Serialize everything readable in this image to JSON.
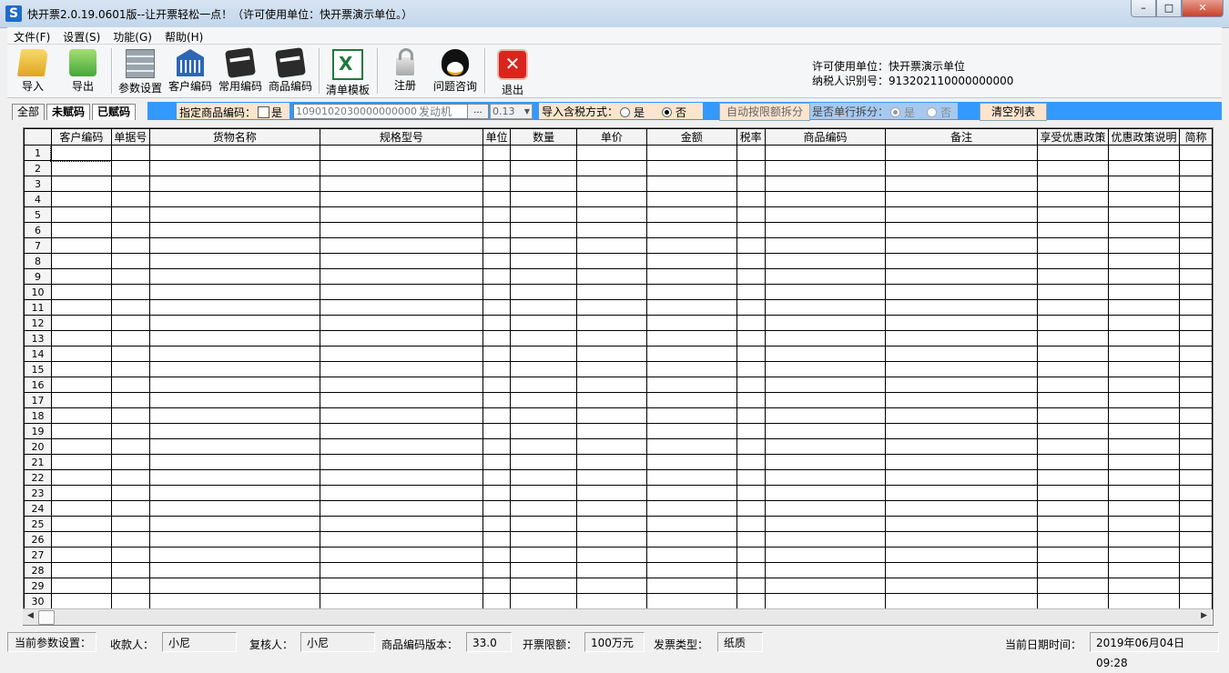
{
  "window": {
    "title": "快开票2.0.19.0601版--让开票轻松一点！（许可使用单位：快开票演示单位。）",
    "app_icon": "S",
    "minimize": "–",
    "maximize": "□",
    "close": "✕"
  },
  "menu": [
    {
      "label": "文件(F)"
    },
    {
      "label": "设置(S)"
    },
    {
      "label": "功能(G)"
    },
    {
      "label": "帮助(H)"
    }
  ],
  "toolbar": {
    "buttons": [
      {
        "label": "导入",
        "icon": "folder-open-icon"
      },
      {
        "label": "导出",
        "icon": "export-arrow-icon"
      },
      {
        "label": "参数设置",
        "icon": "server-icon"
      },
      {
        "label": "客户编码",
        "icon": "bank-icon"
      },
      {
        "label": "常用编码",
        "icon": "card-icon"
      },
      {
        "label": "商品编码",
        "icon": "card-icon"
      },
      {
        "label": "清单模板",
        "icon": "excel-icon"
      },
      {
        "label": "注册",
        "icon": "lock-icon"
      },
      {
        "label": "问题咨询",
        "icon": "qq-penguin-icon"
      },
      {
        "label": "退出",
        "icon": "exit-icon"
      }
    ],
    "license_unit": "许可使用单位：快开票演示单位",
    "tax_id": "纳税人识别号：913202110000000000"
  },
  "tabs": [
    {
      "label": "全部"
    },
    {
      "label": "未赋码"
    },
    {
      "label": "已赋码"
    }
  ],
  "filter": {
    "specify_code_label": "指定商品编码：",
    "specify_code_yes": "是",
    "code_value": "1090102030000000000",
    "code_name": "发动机",
    "browse": "...",
    "rate": "0.13",
    "tax_mode_label": "导入含税方式：",
    "tax_yes": "是",
    "tax_no": "否",
    "auto_split_btn": "自动按限额拆分",
    "single_split_label": "是否单行拆分：",
    "split_yes": "是",
    "split_no": "否",
    "clear_btn": "清空列表"
  },
  "grid": {
    "columns": [
      "客户编码",
      "单据号",
      "货物名称",
      "规格型号",
      "单位",
      "数量",
      "单价",
      "金额",
      "税率",
      "商品编码",
      "备注",
      "享受优惠政策",
      "优惠政策说明",
      "简称"
    ],
    "row_numbers": [
      "1",
      "2",
      "3",
      "4",
      "5",
      "6",
      "7",
      "8",
      "9",
      "10",
      "11",
      "12",
      "13",
      "14",
      "15",
      "16",
      "17",
      "18",
      "19",
      "20",
      "21",
      "22",
      "23",
      "24",
      "25",
      "26",
      "27",
      "28",
      "29",
      "30"
    ]
  },
  "status": {
    "params_label": "当前参数设置：",
    "payee_label": "收款人：",
    "payee": "小尼",
    "reviewer_label": "复核人：",
    "reviewer": "小尼",
    "code_version_label": "商品编码版本：",
    "code_version": "33.0",
    "limit_label": "开票限额：",
    "limit": "100万元",
    "invoice_type_label": "发票类型：",
    "invoice_type": "纸质",
    "datetime_label": "当前日期时间：",
    "datetime": "2019年06月04日 09:28"
  }
}
